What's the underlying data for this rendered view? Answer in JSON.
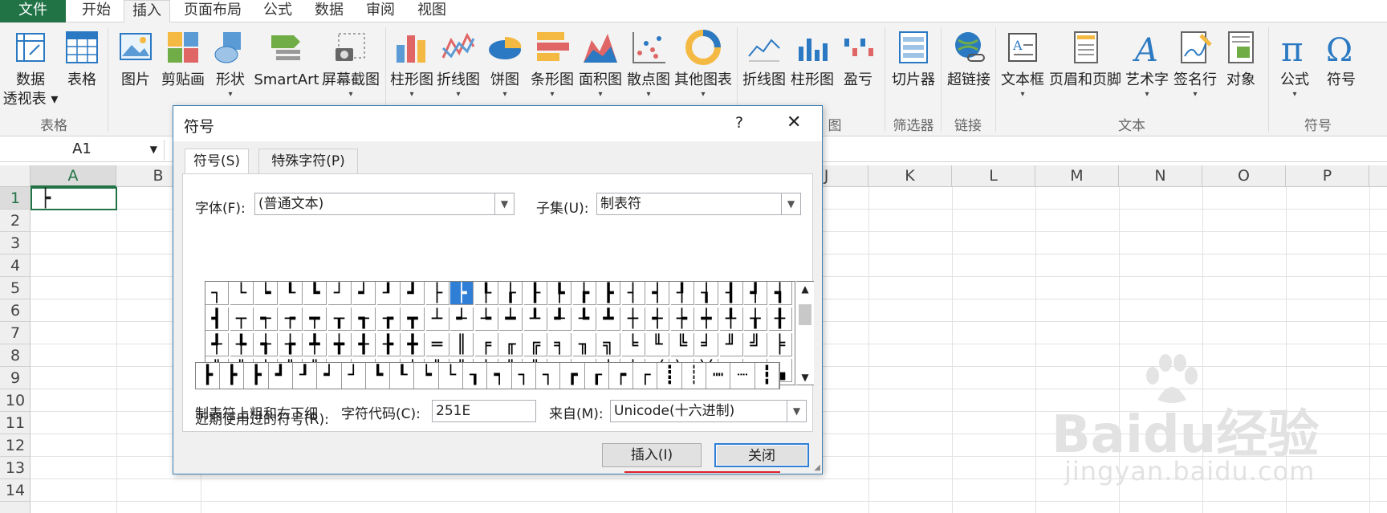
{
  "ribbon_tabs": [
    "文件",
    "开始",
    "插入",
    "页面布局",
    "公式",
    "数据",
    "审阅",
    "视图"
  ],
  "ribbon": {
    "buttons": [
      {
        "label": "数据",
        "label2": "透视表",
        "icon": "pivot-table-icon"
      },
      {
        "label": "表格",
        "icon": "table-icon"
      },
      {
        "label": "图片",
        "icon": "picture-icon"
      },
      {
        "label": "剪贴画",
        "icon": "clipart-icon"
      },
      {
        "label": "形状",
        "icon": "shapes-icon"
      },
      {
        "label": "SmartArt",
        "icon": "smartart-icon"
      },
      {
        "label": "屏幕截图",
        "icon": "screenshot-icon"
      },
      {
        "label": "柱形图",
        "icon": "column-chart-icon"
      },
      {
        "label": "折线图",
        "icon": "line-chart-icon"
      },
      {
        "label": "饼图",
        "icon": "pie-chart-icon"
      },
      {
        "label": "条形图",
        "icon": "bar-chart-icon"
      },
      {
        "label": "面积图",
        "icon": "area-chart-icon"
      },
      {
        "label": "散点图",
        "icon": "scatter-chart-icon"
      },
      {
        "label": "其他图表",
        "icon": "other-chart-icon"
      },
      {
        "label": "折线图",
        "icon": "sparkline-line-icon"
      },
      {
        "label": "柱形图",
        "icon": "sparkline-column-icon"
      },
      {
        "label": "盈亏",
        "icon": "sparkline-winloss-icon"
      },
      {
        "label": "切片器",
        "icon": "slicer-icon"
      },
      {
        "label": "超链接",
        "icon": "hyperlink-icon"
      },
      {
        "label": "文本框",
        "icon": "textbox-icon"
      },
      {
        "label": "页眉和页脚",
        "icon": "header-footer-icon"
      },
      {
        "label": "艺术字",
        "icon": "wordart-icon"
      },
      {
        "label": "签名行",
        "icon": "signature-icon"
      },
      {
        "label": "对象",
        "icon": "object-icon"
      },
      {
        "label": "公式",
        "icon": "equation-icon"
      },
      {
        "label": "符号",
        "icon": "symbol-icon"
      }
    ],
    "groups": [
      "表格",
      "图",
      "筛选器",
      "链接",
      "文本",
      "符号"
    ]
  },
  "name_box": "A1",
  "columns": [
    "A",
    "B",
    "J",
    "K",
    "L",
    "M",
    "N",
    "O",
    "P"
  ],
  "rows": [
    "1",
    "2",
    "3",
    "4",
    "5",
    "6",
    "7",
    "8",
    "9",
    "10",
    "11",
    "12",
    "13",
    "14"
  ],
  "cell_a1": "┝",
  "dialog": {
    "title": "符号",
    "help": "?",
    "close": "✕",
    "tabs": [
      "符号(S)",
      "特殊字符(P)"
    ],
    "font_label": "字体(F):",
    "font_value": "(普通文本)",
    "subset_label": "子集(U):",
    "subset_value": "制表符",
    "symbols": [
      "┐",
      "└",
      "┕",
      "┖",
      "┗",
      "┘",
      "┙",
      "┚",
      "┛",
      "├",
      "┝",
      "┞",
      "┟",
      "┠",
      "┡",
      "┢",
      "┣",
      "┤",
      "┥",
      "┦",
      "┧",
      "┨",
      "┩",
      "┪",
      "┫",
      "┬",
      "┭",
      "┮",
      "┯",
      "┰",
      "┱",
      "┲",
      "┳",
      "┴",
      "┵",
      "┶",
      "┷",
      "┸",
      "┹",
      "┺",
      "┻",
      "┼",
      "┽",
      "┾",
      "┿",
      "╀",
      "╁",
      "╂",
      "╃",
      "╄",
      "╅",
      "╆",
      "╇",
      "╈",
      "╉",
      "╊",
      "╋",
      "═",
      "║",
      "╒",
      "╓",
      "╔",
      "╕",
      "╖",
      "╗",
      "╘",
      "╙",
      "╚",
      "╛",
      "╜",
      "╝",
      "╞",
      "╟",
      "╠",
      "╡",
      "╢",
      "╣",
      "╤",
      "╥",
      "╦",
      "╧",
      "╨",
      "╩",
      "╪",
      "╫",
      "╬",
      "╭",
      "╮",
      "╯",
      "╰",
      "╱",
      "╲",
      "╳",
      "▁",
      "▂",
      "▃"
    ],
    "selected_symbol": "┝",
    "recent_label": "近期使用过的符号(R):",
    "recent": [
      "┣",
      "┣",
      "┣",
      "┛",
      "┚",
      "┙",
      "┘",
      "┗",
      "┖",
      "┕",
      "└",
      "┒",
      "┑",
      "┐",
      "┐",
      "┏",
      "┎",
      "┍",
      "┌",
      "┋",
      "┊",
      "┉",
      "┈",
      "┇"
    ],
    "char_name": "制表符上粗和右下细",
    "code_label": "字符代码(C):",
    "code_value": "251E",
    "from_label": "来自(M):",
    "from_value": "Unicode(十六进制)",
    "insert_button": "插入(I)",
    "close_button": "关闭"
  },
  "watermark": {
    "brand": "Baidu",
    "text": "经验",
    "url": "jingyan.baidu.com"
  },
  "colors": {
    "excel_green": "#217346",
    "selection_blue": "#2f7fd6",
    "underline_red": "#e0202a"
  }
}
